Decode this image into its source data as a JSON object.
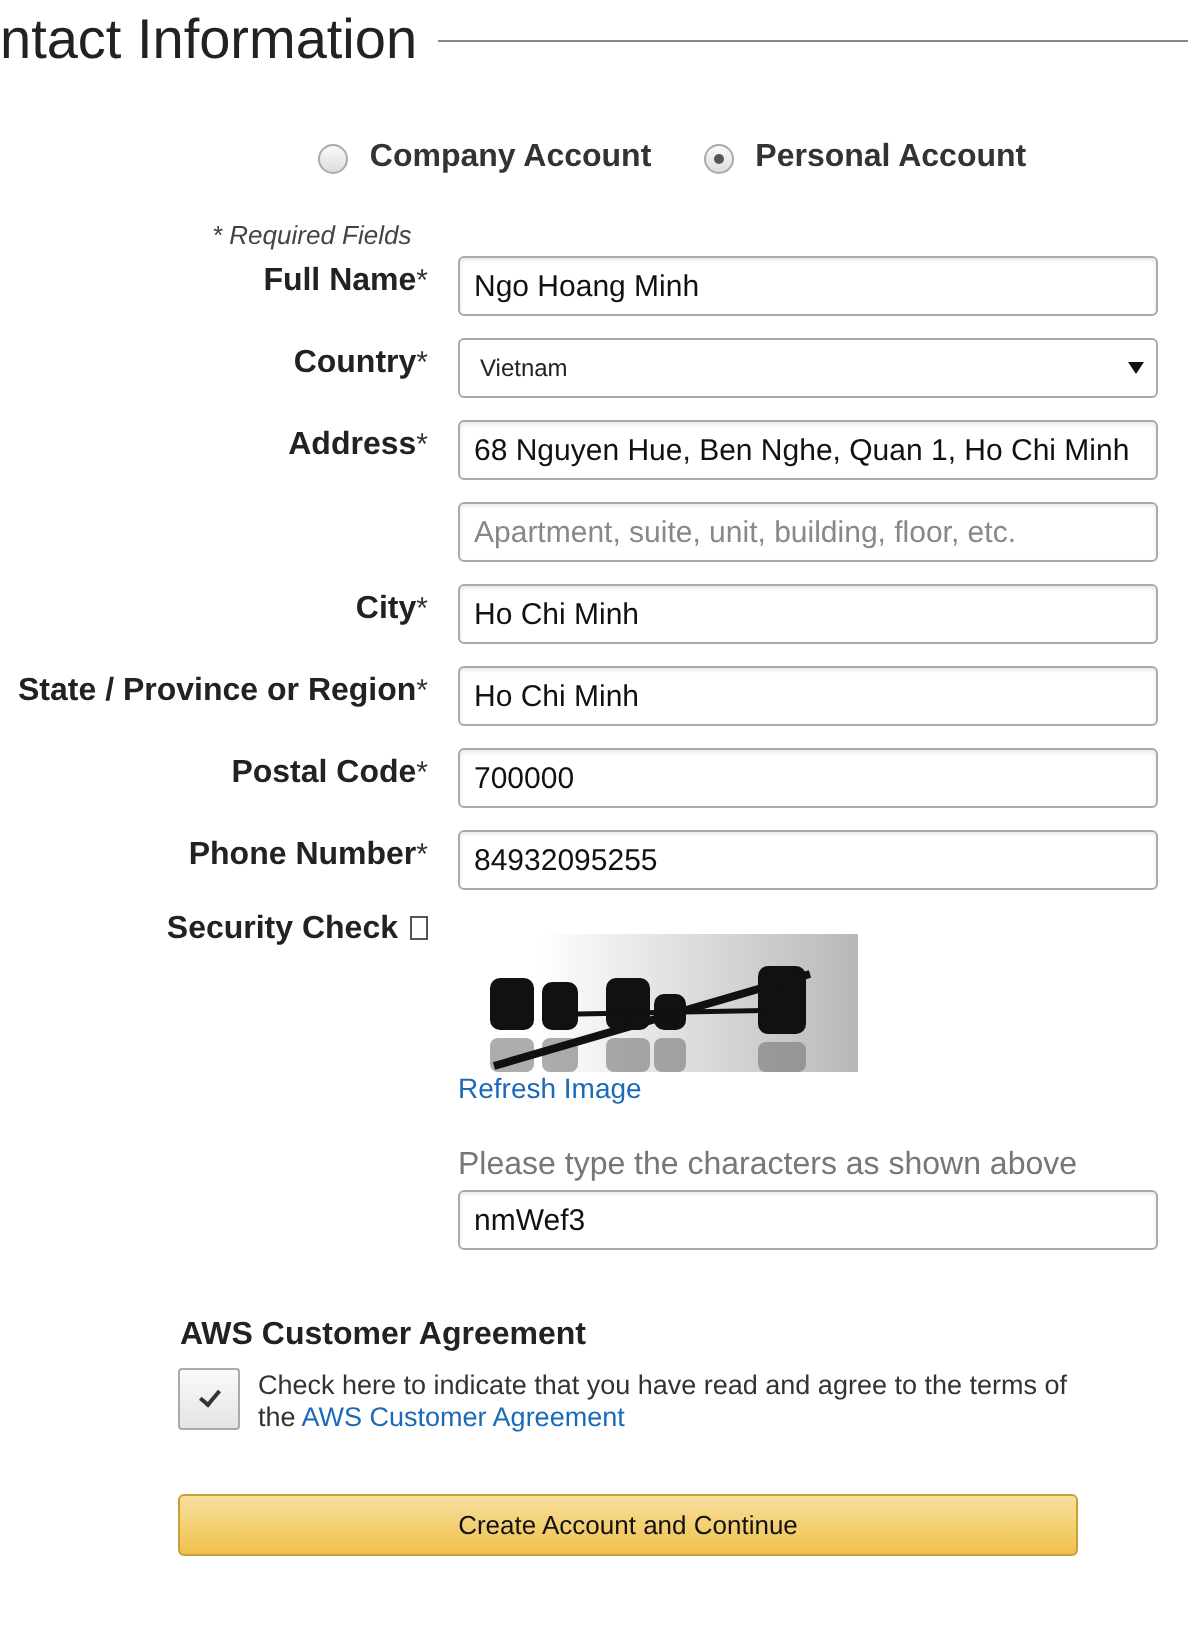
{
  "heading": "ntact Information",
  "account_types": [
    {
      "label": "Company Account",
      "selected": false
    },
    {
      "label": "Personal Account",
      "selected": true
    }
  ],
  "required_note": "* Required Fields",
  "fields": [
    {
      "kind": "text",
      "label": "Full Name",
      "required_mark": "*",
      "value": "Ngo Hoang Minh"
    },
    {
      "kind": "select",
      "label": "Country",
      "required_mark": "*",
      "value": "Vietnam"
    },
    {
      "kind": "text",
      "label": "Address",
      "required_mark": "*",
      "value": "68 Nguyen Hue, Ben Nghe, Quan 1, Ho Chi Minh"
    },
    {
      "kind": "text",
      "placeholder": "Apartment, suite, unit, building, floor, etc."
    },
    {
      "kind": "text",
      "label": "City",
      "required_mark": "*",
      "value": "Ho Chi Minh"
    },
    {
      "kind": "text",
      "label": "State / Province or Region",
      "required_mark": "*",
      "value": "Ho Chi Minh"
    },
    {
      "kind": "text",
      "label": "Postal Code",
      "required_mark": "*",
      "value": "700000"
    },
    {
      "kind": "text",
      "label": "Phone Number",
      "required_mark": "*",
      "value": "84932095255"
    }
  ],
  "security": {
    "label": "Security Check",
    "refresh_link": "Refresh Image",
    "prompt": "Please type the characters as shown above",
    "value": "nmWef3"
  },
  "agreement": {
    "title": "AWS Customer Agreement",
    "checked": true,
    "text": "Check here to indicate that you have read and agree to the terms of the ",
    "link": "AWS Customer Agreement"
  },
  "submit_button": "Create Account and Continue"
}
